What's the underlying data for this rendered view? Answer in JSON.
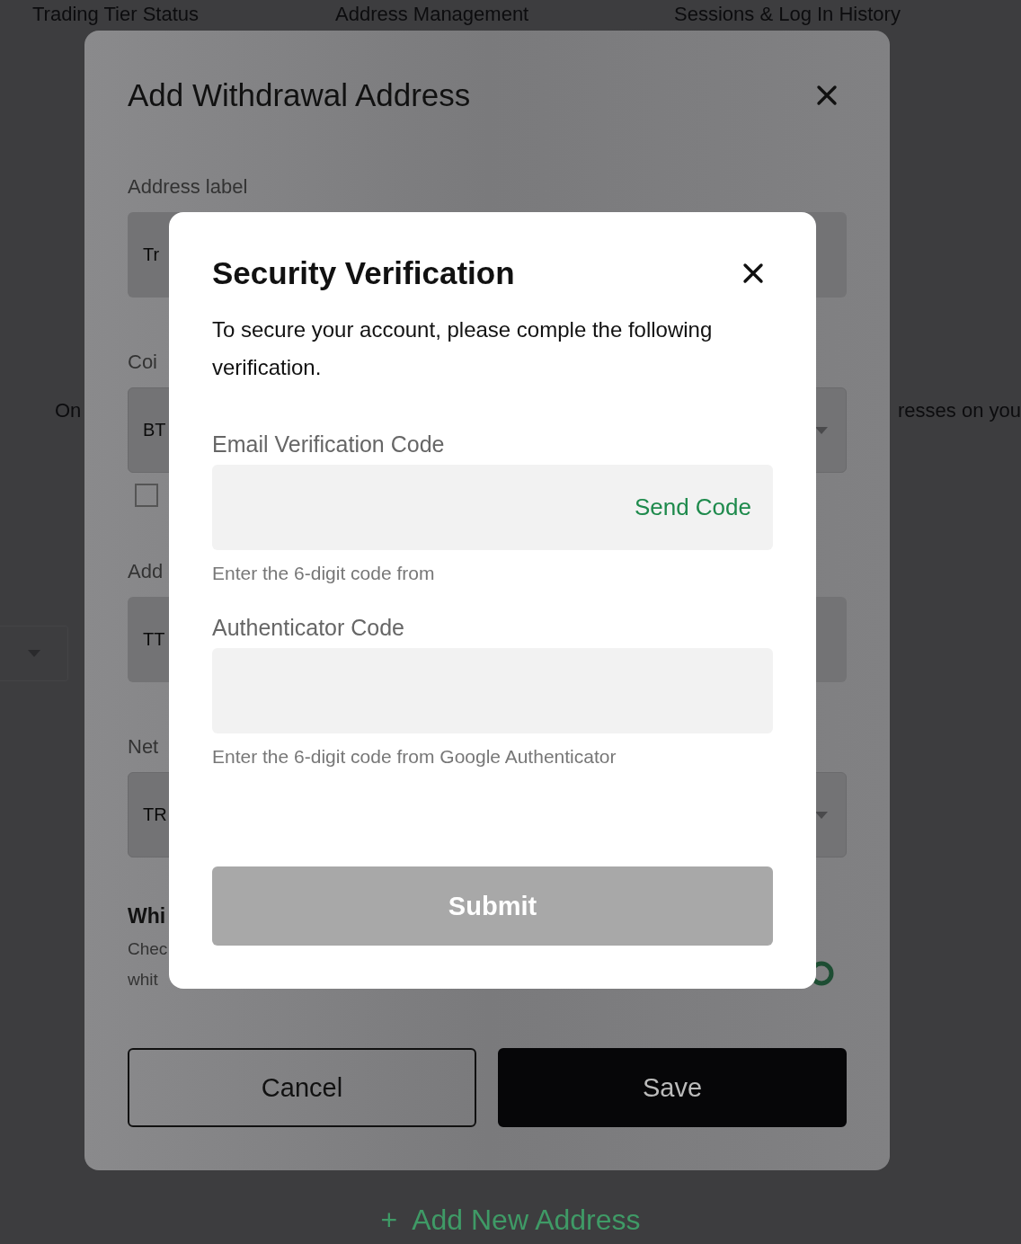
{
  "page": {
    "tabs": [
      "Trading Tier Status",
      "Address Management",
      "Sessions & Log In History"
    ],
    "notice_left": "On",
    "notice_right": "resses on you",
    "add_address": {
      "icon": "+",
      "label": "Add New Address"
    }
  },
  "dialog": {
    "title": "Add Withdrawal Address",
    "fields": [
      {
        "label": "Address label",
        "value": "Tr",
        "kind": "text"
      },
      {
        "label": "Coi",
        "value": "BT",
        "kind": "select",
        "checkbox": {
          "checked": false
        }
      },
      {
        "label": "Add",
        "value": "TT",
        "kind": "text"
      },
      {
        "label": "Net",
        "value": "TR",
        "kind": "select"
      }
    ],
    "whitelist": {
      "title": "Whi",
      "description": [
        "Chec",
        "whit"
      ]
    },
    "buttons": [
      {
        "label": "Cancel",
        "kind": "secondary"
      },
      {
        "label": "Save",
        "kind": "primary"
      }
    ]
  },
  "verification": {
    "title": "Security Verification",
    "description": "To secure your account, please comple the following verification.",
    "fields": [
      {
        "label": "Email Verification Code",
        "action": "Send Code",
        "hint": "Enter the 6-digit code from"
      },
      {
        "label": "Authenticator Code",
        "hint": "Enter the 6-digit code from Google Authenticator"
      }
    ],
    "submit": {
      "label": "Submit",
      "disabled": true
    }
  }
}
